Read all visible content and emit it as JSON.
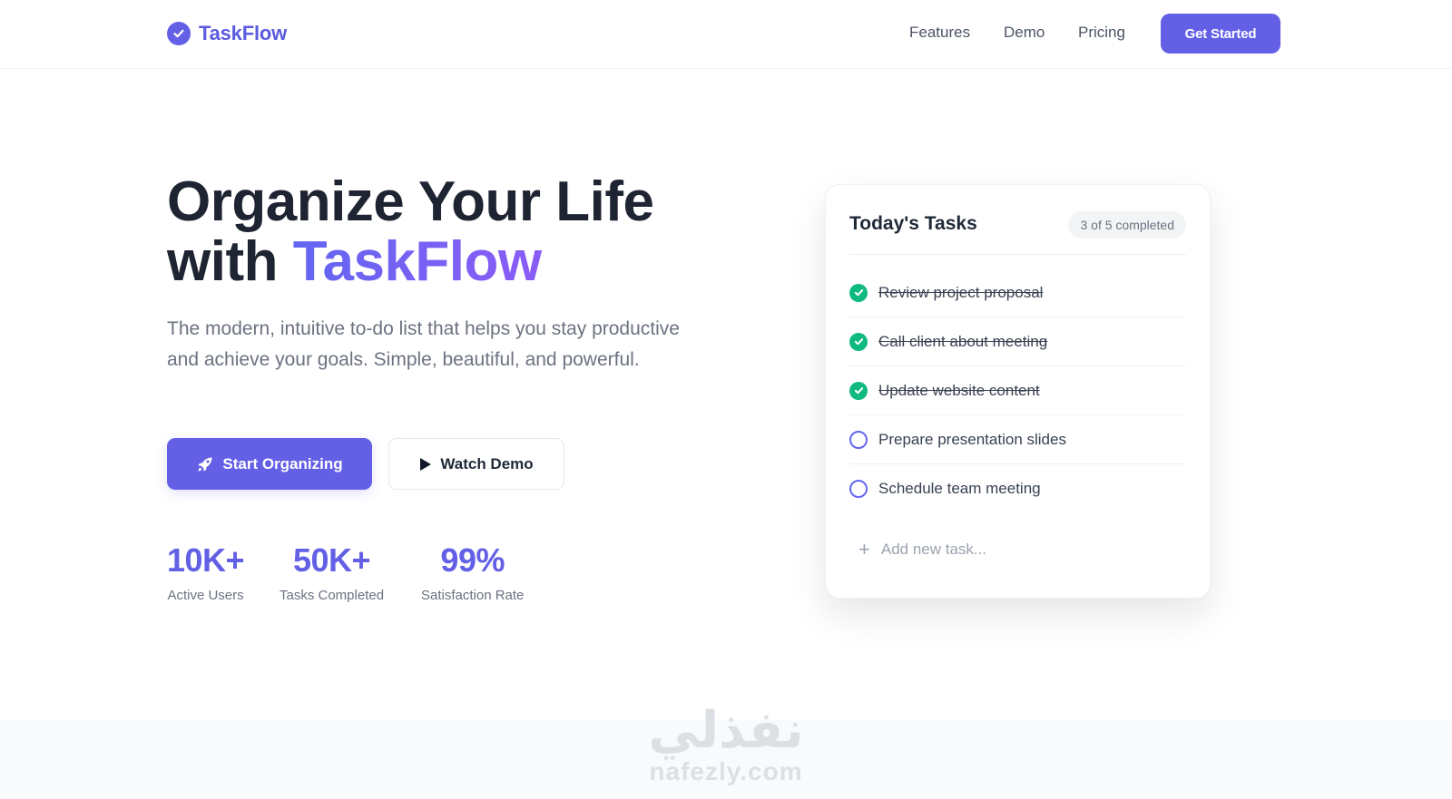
{
  "nav": {
    "brand": "TaskFlow",
    "links": [
      "Features",
      "Demo",
      "Pricing"
    ],
    "cta": "Get Started"
  },
  "hero": {
    "title_line1": "Organize Your Life",
    "title_with": "with",
    "title_accent": "TaskFlow",
    "subtitle": "The modern, intuitive to-do list that helps you stay productive and achieve your goals. Simple, beautiful, and powerful.",
    "primary_button": "Start Organizing",
    "secondary_button": "Watch Demo",
    "stats": [
      {
        "value": "10K+",
        "label": "Active Users"
      },
      {
        "value": "50K+",
        "label": "Tasks Completed"
      },
      {
        "value": "99%",
        "label": "Satisfaction Rate"
      }
    ]
  },
  "card": {
    "title": "Today's Tasks",
    "badge": "3 of 5 completed",
    "tasks": [
      {
        "label": "Review project proposal",
        "done": true
      },
      {
        "label": "Call client about meeting",
        "done": true
      },
      {
        "label": "Update website content",
        "done": true
      },
      {
        "label": "Prepare presentation slides",
        "done": false
      },
      {
        "label": "Schedule team meeting",
        "done": false
      }
    ],
    "add_placeholder": "Add new task..."
  },
  "watermark": {
    "arabic": "نفذلي",
    "latin": "nafezly.com"
  },
  "colors": {
    "primary": "#6360e6",
    "accent_gradient_start": "#6366f1",
    "accent_gradient_end": "#8b5cf6",
    "done": "#10b981"
  },
  "icons": [
    "check-circle-icon",
    "rocket-icon",
    "play-icon",
    "plus-icon"
  ]
}
